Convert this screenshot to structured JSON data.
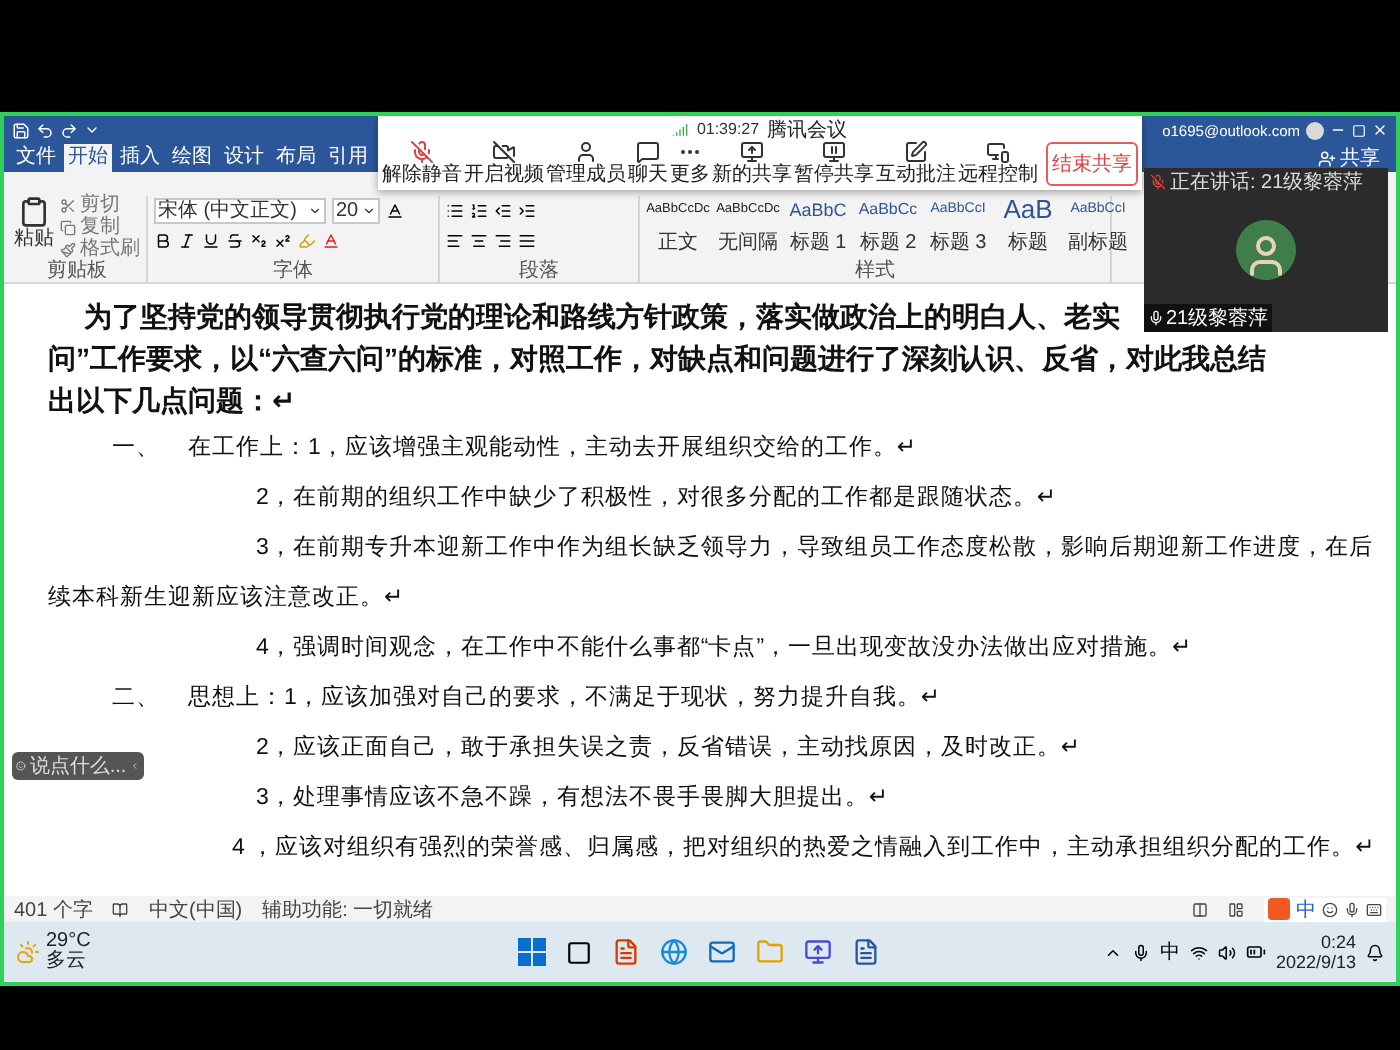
{
  "meeting_toolbar": {
    "time": "01:39:27",
    "title": "腾讯会议",
    "buttons": [
      {
        "kind": "mic",
        "label": "解除静音"
      },
      {
        "kind": "video",
        "label": "开启视频"
      },
      {
        "kind": "members",
        "label": "管理成员"
      },
      {
        "kind": "chat",
        "label": "聊天"
      },
      {
        "kind": "more",
        "label": "更多"
      },
      {
        "kind": "share",
        "label": "新的共享"
      },
      {
        "kind": "pause",
        "label": "暂停共享"
      },
      {
        "kind": "annotate",
        "label": "互动批注"
      },
      {
        "kind": "remote",
        "label": "远程控制"
      }
    ],
    "end_button": "结束共享"
  },
  "word": {
    "account": "o1695@outlook.com",
    "tabs": [
      {
        "label": "文件",
        "selected": false
      },
      {
        "label": "开始",
        "selected": true
      },
      {
        "label": "插入",
        "selected": false
      },
      {
        "label": "绘图",
        "selected": false
      },
      {
        "label": "设计",
        "selected": false
      },
      {
        "label": "布局",
        "selected": false
      },
      {
        "label": "引用",
        "selected": false
      }
    ],
    "share_button": "共享",
    "ribbon": {
      "clipboard": {
        "paste": "粘贴",
        "cut": "剪切",
        "copy": "复制",
        "format_painter": "格式刷",
        "group": "剪贴板"
      },
      "font": {
        "name": "宋体 (中文正文)",
        "size": "20",
        "group": "字体"
      },
      "paragraph": {
        "group": "段落"
      },
      "styles": {
        "items": [
          {
            "kind": "normal",
            "sample": "AaBbCcDc",
            "label": "正文"
          },
          {
            "kind": "normal",
            "sample": "AaBbCcDc",
            "label": "无间隔"
          },
          {
            "kind": "heading1",
            "sample": "AaBbC",
            "label": "标题 1"
          },
          {
            "kind": "heading2",
            "sample": "AaBbCc",
            "label": "标题 2"
          },
          {
            "kind": "heading3",
            "sample": "AaBbCcI",
            "label": "标题 3"
          },
          {
            "kind": "title",
            "sample": "AaB",
            "label": "标题"
          },
          {
            "kind": "subtitle",
            "sample": "AaBbCcI",
            "label": "副标题"
          }
        ],
        "group": "样式"
      }
    },
    "document": {
      "intro": [
        "为了坚持党的领导贯彻执行党的理论和路线方针政策，落实做政治上的明白人、老实",
        "问”工作要求，以“六查六问”的标准，对照工作，对缺点和问题进行了深刻认识、反省，对此我总结",
        "出以下几点问题：↵"
      ],
      "lines": [
        {
          "kind": "section",
          "marker": "一、",
          "text": "在工作上：1，应该增强主观能动性，主动去开展组织交给的工作。↵"
        },
        {
          "kind": "point",
          "text": "2，在前期的组织工作中缺少了积极性，对很多分配的工作都是跟随状态。↵"
        },
        {
          "kind": "point",
          "text": "3，在前期专升本迎新工作中作为组长缺乏领导力，导致组员工作态度松散，影响后期迎新工作进度，在后"
        },
        {
          "kind": "continuation",
          "text": "续本科新生迎新应该注意改正。↵"
        },
        {
          "kind": "point",
          "text": "4，强调时间观念，在工作中不能什么事都“卡点”，一旦出现变故没办法做出应对措施。↵"
        },
        {
          "kind": "section",
          "marker": "二、",
          "text": "思想上：1，应该加强对自己的要求，不满足于现状，努力提升自我。↵"
        },
        {
          "kind": "point",
          "text": "2，应该正面自己，敢于承担失误之责，反省错误，主动找原因，及时改正。↵"
        },
        {
          "kind": "point",
          "text": "3，处理事情应该不急不躁，有想法不畏手畏脚大胆提出。↵"
        },
        {
          "kind": "point_wide",
          "text": "4 ，应该对组织有强烈的荣誉感、归属感，把对组织的热爱之情融入到工作中，主动承担组织分配的工作。↵"
        }
      ]
    },
    "status_bar": {
      "word_count": "401 个字",
      "language": "中文(中国)",
      "accessibility": "辅助功能: 一切就绪"
    }
  },
  "ime_bar": {
    "mode": "中"
  },
  "video_panel": {
    "speaking": "正在讲话: 21级黎蓉萍",
    "name": "21级黎蓉萍"
  },
  "chat_pill": {
    "placeholder": "说点什么..."
  },
  "taskbar": {
    "temperature": "29°C",
    "weather": "多云",
    "ime": "中",
    "time": "0:24",
    "date": "2022/9/13"
  }
}
